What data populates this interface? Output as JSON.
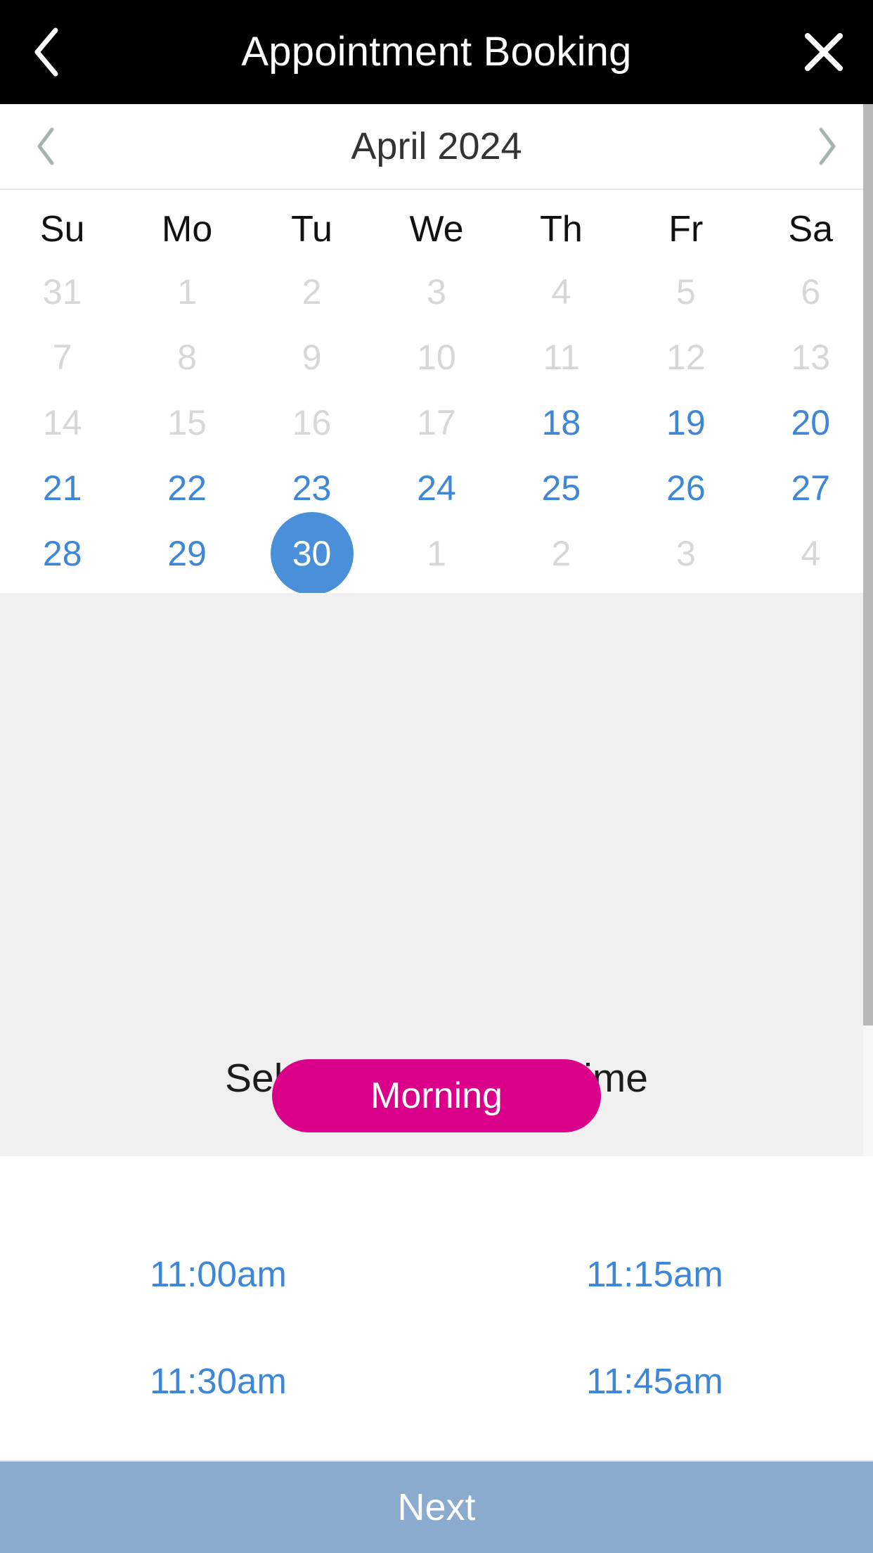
{
  "header": {
    "title": "Appointment Booking",
    "back_icon": "chevron-left-icon",
    "close_icon": "close-x-icon"
  },
  "calendar": {
    "month_label": "April 2024",
    "prev_icon": "chevron-left-icon",
    "next_icon": "chevron-right-icon",
    "weekdays": [
      "Su",
      "Mo",
      "Tu",
      "We",
      "Th",
      "Fr",
      "Sa"
    ],
    "selected_day": "30",
    "days": [
      {
        "n": "31",
        "state": "disabled"
      },
      {
        "n": "1",
        "state": "disabled"
      },
      {
        "n": "2",
        "state": "disabled"
      },
      {
        "n": "3",
        "state": "disabled"
      },
      {
        "n": "4",
        "state": "disabled"
      },
      {
        "n": "5",
        "state": "disabled"
      },
      {
        "n": "6",
        "state": "disabled"
      },
      {
        "n": "7",
        "state": "disabled"
      },
      {
        "n": "8",
        "state": "disabled"
      },
      {
        "n": "9",
        "state": "disabled"
      },
      {
        "n": "10",
        "state": "disabled"
      },
      {
        "n": "11",
        "state": "disabled"
      },
      {
        "n": "12",
        "state": "disabled"
      },
      {
        "n": "13",
        "state": "disabled"
      },
      {
        "n": "14",
        "state": "disabled"
      },
      {
        "n": "15",
        "state": "disabled"
      },
      {
        "n": "16",
        "state": "disabled"
      },
      {
        "n": "17",
        "state": "disabled"
      },
      {
        "n": "18",
        "state": "available"
      },
      {
        "n": "19",
        "state": "available"
      },
      {
        "n": "20",
        "state": "available"
      },
      {
        "n": "21",
        "state": "available"
      },
      {
        "n": "22",
        "state": "available"
      },
      {
        "n": "23",
        "state": "available"
      },
      {
        "n": "24",
        "state": "available"
      },
      {
        "n": "25",
        "state": "available"
      },
      {
        "n": "26",
        "state": "available"
      },
      {
        "n": "27",
        "state": "available"
      },
      {
        "n": "28",
        "state": "available"
      },
      {
        "n": "29",
        "state": "available"
      },
      {
        "n": "30",
        "state": "selected"
      },
      {
        "n": "1",
        "state": "disabled"
      },
      {
        "n": "2",
        "state": "disabled"
      },
      {
        "n": "3",
        "state": "disabled"
      },
      {
        "n": "4",
        "state": "disabled"
      }
    ]
  },
  "time_section": {
    "heading": "Select an available time",
    "period_label": "Morning",
    "slots": [
      "11:00am",
      "11:15am",
      "11:30am",
      "11:45am"
    ]
  },
  "footer": {
    "next_label": "Next"
  },
  "colors": {
    "header_bg": "#000000",
    "available_blue": "#3d86d8",
    "selected_blue": "#4a90d9",
    "disabled_gray": "#d4d8d9",
    "period_magenta": "#da0089",
    "next_button_bg": "#8aabcd",
    "panel_gray": "#f0f0f0",
    "scrollbar_thumb": "#b8b8b8"
  }
}
